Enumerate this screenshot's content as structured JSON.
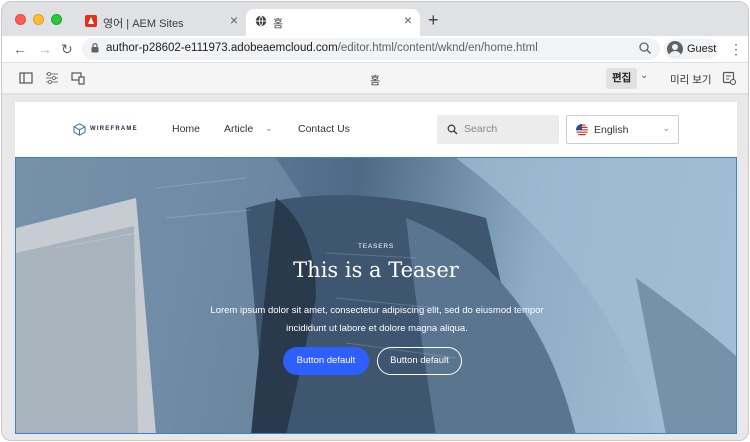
{
  "browser": {
    "tabs": [
      {
        "title": "영어 | AEM Sites",
        "favicon": "adobe-icon",
        "active": false
      },
      {
        "title": "홈",
        "favicon": "globe-icon",
        "active": true
      }
    ],
    "close_glyph": "×",
    "new_tab_glyph": "+",
    "back_glyph": "←",
    "forward_glyph": "→",
    "reload_glyph": "↻",
    "menu_glyph": "⋮",
    "url_host": "author-p28602-e111973.adobeaemcloud.com",
    "url_path": "/editor.html/content/wknd/en/home.html",
    "profile_name": "Guest"
  },
  "editor": {
    "page_title": "홈",
    "mode_label": "편집",
    "mode_chevron": "⌄",
    "preview_label": "미리 보기"
  },
  "site": {
    "logo_text": "WIREFRAME",
    "nav": [
      {
        "label": "Home"
      },
      {
        "label": "Article",
        "has_dropdown": true
      },
      {
        "label": "Contact Us"
      }
    ],
    "nav_chevron": "⌄",
    "search_placeholder": "Search",
    "language": "English",
    "language_chevron": "⌄"
  },
  "teaser": {
    "eyebrow": "TEASERS",
    "title": "This is a Teaser",
    "description": "Lorem ipsum dolor sit amet, consectetur adipiscing elit, sed do eiusmod tempor incididunt ut labore et dolore magna aliqua.",
    "primary_button": "Button default",
    "secondary_button": "Button default"
  },
  "colors": {
    "primary_button": "#2f5eff",
    "adobe_red": "#e0301e",
    "selection_border": "#3b82c4"
  }
}
